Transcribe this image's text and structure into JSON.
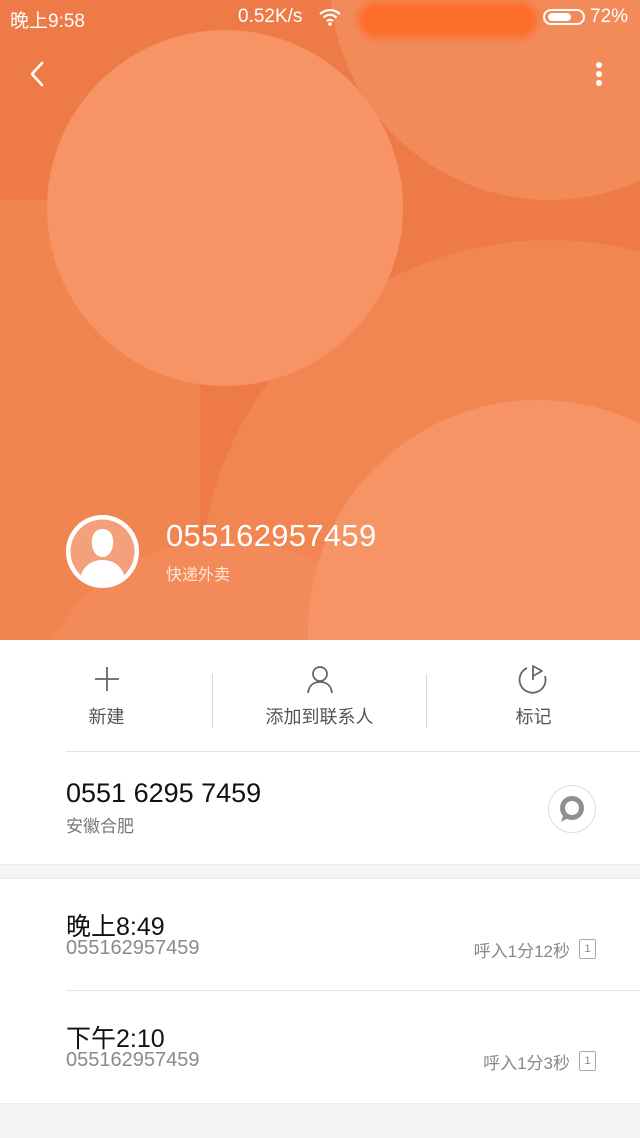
{
  "status_bar": {
    "time": "晚上9:58",
    "speed": "0.52K/s",
    "battery_level": 0.72,
    "battery_text": "72%",
    "icons": [
      "wifi-icon",
      "battery-icon"
    ]
  },
  "header": {
    "back_icon": "chevron-left-icon",
    "more_icon": "more-vertical-icon"
  },
  "caller": {
    "number": "055162957459",
    "tag": "快递外卖",
    "avatar_icon": "person-silhouette-icon"
  },
  "actions": [
    {
      "label": "新建",
      "icon": "plus-icon"
    },
    {
      "label": "添加到联系人",
      "icon": "person-outline-icon"
    },
    {
      "label": "标记",
      "icon": "flag-icon"
    }
  ],
  "number_info": {
    "number": "0551 6295 7459",
    "location": "安徽合肥",
    "message_icon": "message-bubble-icon"
  },
  "call_log": [
    {
      "time": "晚上8:49",
      "number": "055162957459",
      "detail": "呼入1分12秒",
      "sim": "1"
    },
    {
      "time": "下午2:10",
      "number": "055162957459",
      "detail": "呼入1分3秒",
      "sim": "1"
    }
  ],
  "colors": {
    "hero_bg": "#ee7a47",
    "hero_shape_light": "#f69466",
    "text_primary": "#111111",
    "text_secondary": "#888888"
  }
}
